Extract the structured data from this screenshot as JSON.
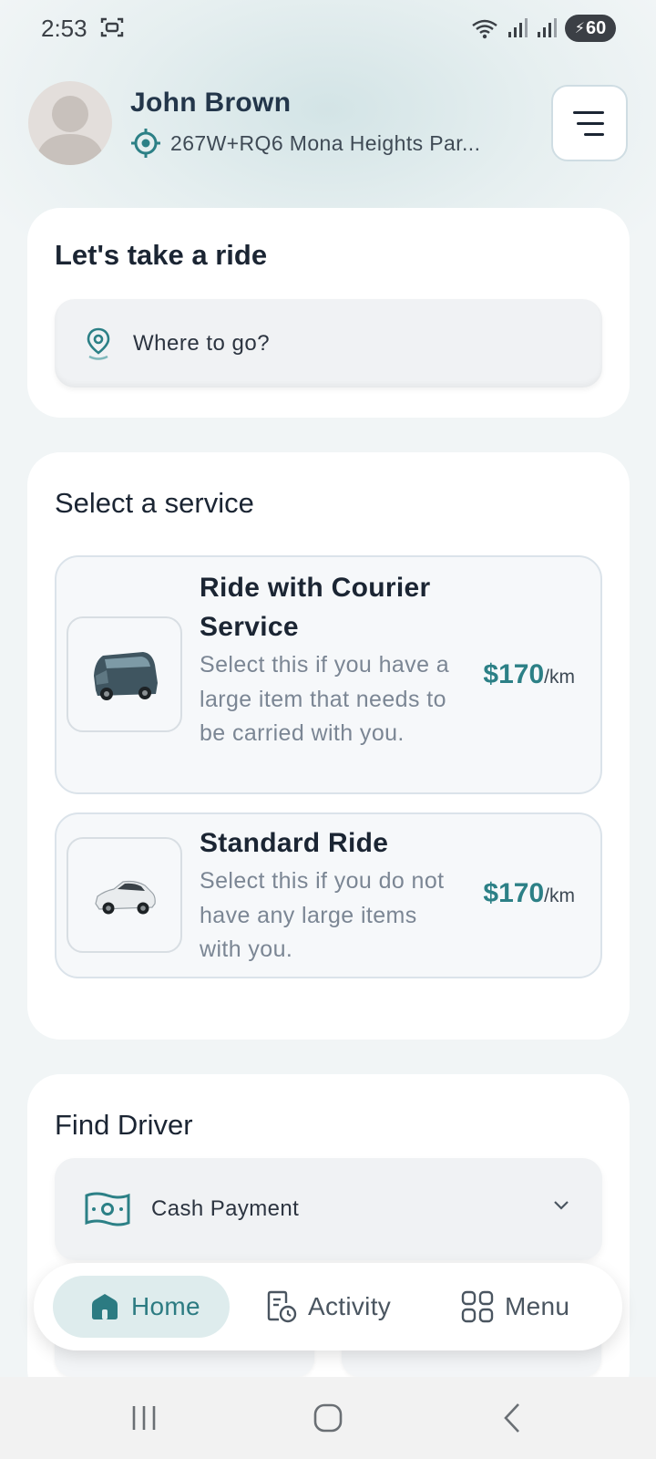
{
  "status_bar": {
    "time": "2:53",
    "battery": "60"
  },
  "header": {
    "user_name": "John Brown",
    "location": "267W+RQ6 Mona Heights Par..."
  },
  "ride_card": {
    "title": "Let's take a ride",
    "search_placeholder": "Where to go?"
  },
  "service_card": {
    "title": "Select a service",
    "services": [
      {
        "name": "Ride with Courier Service",
        "description": "Select this if you have a large item that needs to be carried with you.",
        "price": "$170",
        "unit": "/km"
      },
      {
        "name": "Standard Ride",
        "description": "Select this if you do not have any large items with you.",
        "price": "$170",
        "unit": "/km"
      }
    ]
  },
  "driver_card": {
    "title": "Find Driver",
    "payment_method": "Cash Payment"
  },
  "bottom_nav": {
    "items": [
      {
        "label": "Home",
        "icon": "home-icon",
        "active": true
      },
      {
        "label": "Activity",
        "icon": "activity-icon",
        "active": false
      },
      {
        "label": "Menu",
        "icon": "grid-menu-icon",
        "active": false
      }
    ]
  },
  "colors": {
    "accent": "#2c8086",
    "active_nav_bg": "#deeced",
    "text_dark": "#1b2533",
    "text_muted": "#7b8694"
  }
}
